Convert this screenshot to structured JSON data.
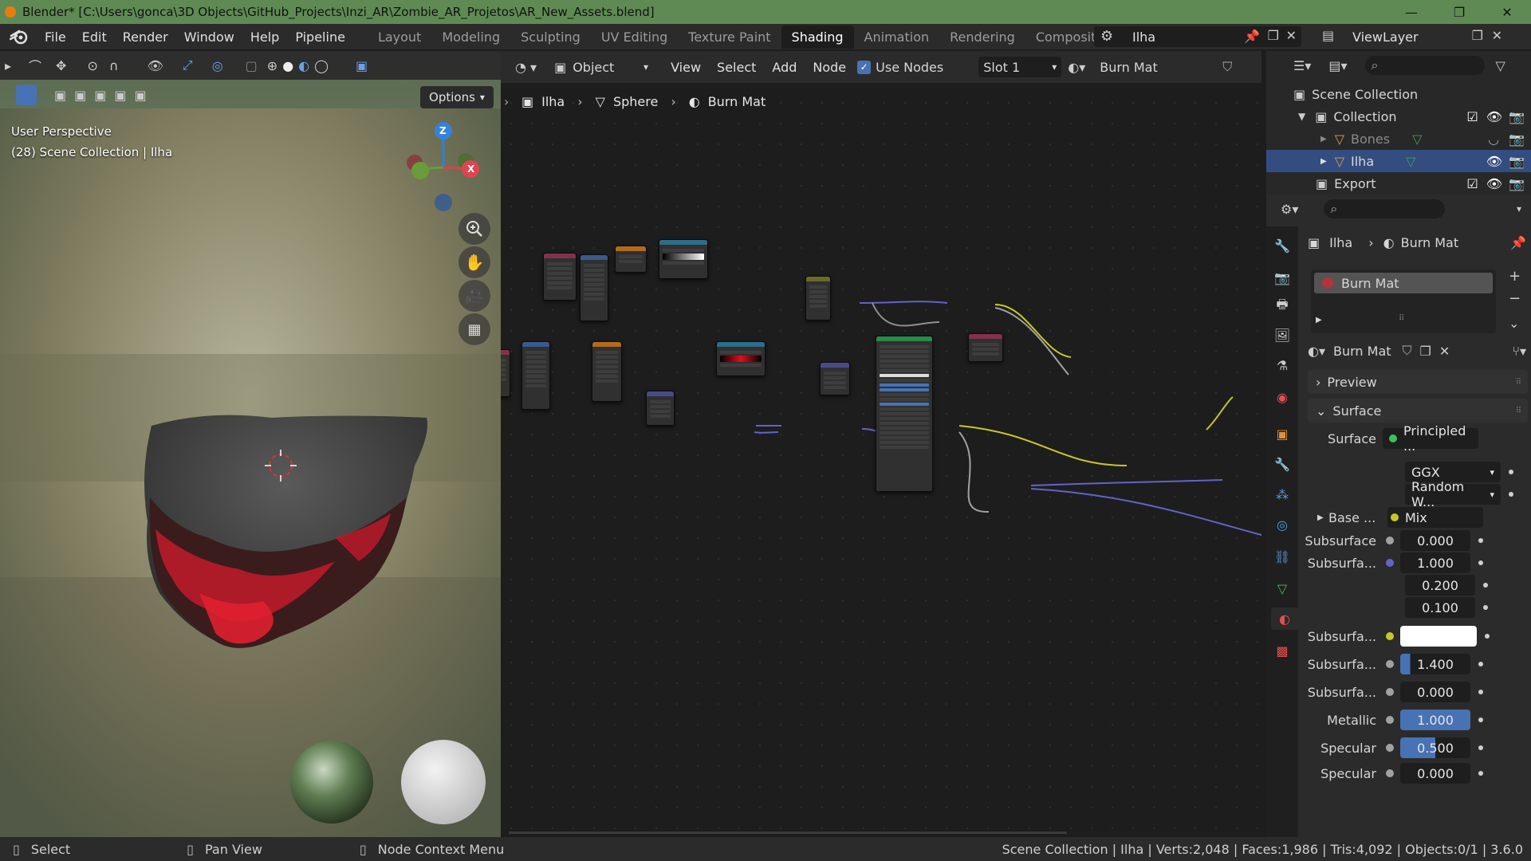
{
  "window": {
    "title": "Blender* [C:\\Users\\gonca\\3D Objects\\GitHub_Projects\\Inzi_AR\\Zombie_AR_Projetos\\AR_New_Assets.blend]"
  },
  "menu": [
    "File",
    "Edit",
    "Render",
    "Window",
    "Help",
    "Pipeline"
  ],
  "workspaces": [
    "Layout",
    "Modeling",
    "Sculpting",
    "UV Editing",
    "Texture Paint",
    "Shading",
    "Animation",
    "Rendering",
    "Compositing"
  ],
  "active_workspace": "Shading",
  "scene_name": "Ilha",
  "view_layer": "ViewLayer",
  "viewport": {
    "options_label": "Options",
    "perspective": "User Perspective",
    "collection_info": "(28) Scene Collection | Ilha",
    "gizmo": {
      "z": "Z",
      "x": "X"
    }
  },
  "node_editor": {
    "mode": "Object",
    "menus": [
      "View",
      "Select",
      "Add",
      "Node"
    ],
    "use_nodes_label": "Use Nodes",
    "use_nodes_checked": true,
    "slot": "Slot 1",
    "material": "Burn Mat",
    "breadcrumb": [
      "Ilha",
      "Sphere",
      "Burn Mat"
    ]
  },
  "outliner": {
    "items": [
      {
        "label": "Scene Collection",
        "level": 0
      },
      {
        "label": "Collection",
        "level": 1
      },
      {
        "label": "Bones",
        "level": 2
      },
      {
        "label": "Ilha",
        "level": 2
      },
      {
        "label": "Export",
        "level": 1
      }
    ]
  },
  "properties": {
    "breadcrumb": [
      "Ilha",
      "Burn Mat"
    ],
    "material_slot": "Burn Mat",
    "material_name": "Burn Mat",
    "panels": {
      "preview": "Preview",
      "surface": "Surface"
    },
    "surface": {
      "surface_label": "Surface",
      "surface_value": "Principled ...",
      "distribution": "GGX",
      "subsurface_method": "Random W...",
      "base_color_label": "Base ...",
      "base_color_value": "Mix",
      "subsurface_label": "Subsurface",
      "subsurface_value": "0.000",
      "subsurface_radius_label": "Subsurfa...",
      "subsurface_radius": [
        "1.000",
        "0.200",
        "0.100"
      ],
      "subsurface_color_label": "Subsurfa...",
      "subsurface_ior_label": "Subsurfa...",
      "subsurface_ior": "1.400",
      "subsurface_aniso_label": "Subsurfa...",
      "subsurface_aniso": "0.000",
      "metallic_label": "Metallic",
      "metallic": "1.000",
      "specular_label": "Specular",
      "specular": "0.500",
      "specular_tint_label": "Specular",
      "specular_tint": "0.000"
    }
  },
  "status": {
    "left": [
      {
        "key": "Select"
      },
      {
        "key": "Pan View"
      },
      {
        "key": "Node Context Menu"
      }
    ],
    "right": "Scene Collection | Ilha | Verts:2,048 | Faces:1,986 | Tris:4,092 | Objects:0/1 | 3.6.0"
  },
  "colors": {
    "titlebar": "#5f8a54",
    "accent_blue": "#4772b3",
    "selection": "#334d80"
  }
}
